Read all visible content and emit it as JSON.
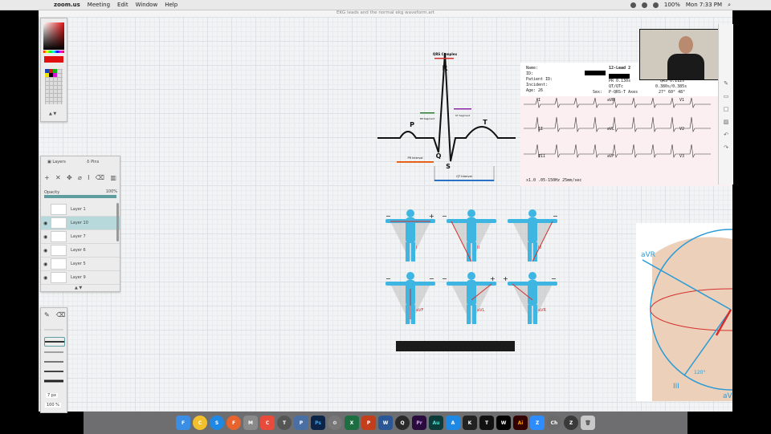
{
  "menubar": {
    "app_name": "zoom.us",
    "items": [
      "Meeting",
      "Edit",
      "Window",
      "Help"
    ],
    "battery": "100%",
    "clock": "Mon 7:33 PM"
  },
  "window_title": "EKG leads and the normal ekg waveform.art",
  "layers_panel": {
    "tabs": [
      "Layers",
      "Pins"
    ],
    "opacity_label": "Opacity",
    "opacity_value": "100%",
    "layers": [
      "Layer 1",
      "Layer 10",
      "Layer 7",
      "Layer 6",
      "Layer 5",
      "Layer 9"
    ],
    "selected_index": 1
  },
  "brush_panel": {
    "size": "7 px",
    "opacity": "100 %"
  },
  "ekg_diagram": {
    "qrs_label": "QRS Complex",
    "r": "R",
    "p": "P",
    "q": "Q",
    "s": "S",
    "t": "T",
    "pr_segment": "PR Segment",
    "st_segment": "ST Segment",
    "pr_interval": "PR Interval",
    "qt_interval": "QT Interval"
  },
  "report": {
    "name": "Name:",
    "id": "ID:",
    "patient_id": "Patient ID:",
    "incident": "Incident:",
    "age": "Age: 26",
    "title": "12-Lead 2",
    "pr": "PR 0.130s",
    "qrs": "QRS 0.112s",
    "qt": "QT/QTc",
    "qt_val": "0.380s/0.385s",
    "paxes": "P-QRS-T Axes",
    "axes_val": "27° 60° 48°",
    "sex": "Sex:",
    "footer": "x1.0 .05-150Hz 25mm/sec",
    "leads": [
      "I",
      "aVR",
      "V1",
      "II",
      "aVL",
      "V2",
      "III",
      "aVF",
      "V3"
    ]
  },
  "limb_leads": [
    "I",
    "II",
    "III",
    "aVF",
    "aVL",
    "aVR"
  ],
  "heart_image": {
    "avr": "aVR",
    "iii": "III",
    "deg": "120°",
    "avf": "aV"
  },
  "dock_apps": [
    "F",
    "C",
    "S",
    "F",
    "M",
    "C",
    "T",
    "P",
    "S",
    "X",
    "P",
    "W",
    "Q",
    "Pr",
    "Au",
    "A",
    "K",
    "T",
    "W",
    "A",
    "Z",
    "Ch",
    "Z"
  ],
  "colors": {
    "accent": "#5f9ea0",
    "ekg_red": "#d32f2f",
    "figure_blue": "#3fb6e2"
  }
}
